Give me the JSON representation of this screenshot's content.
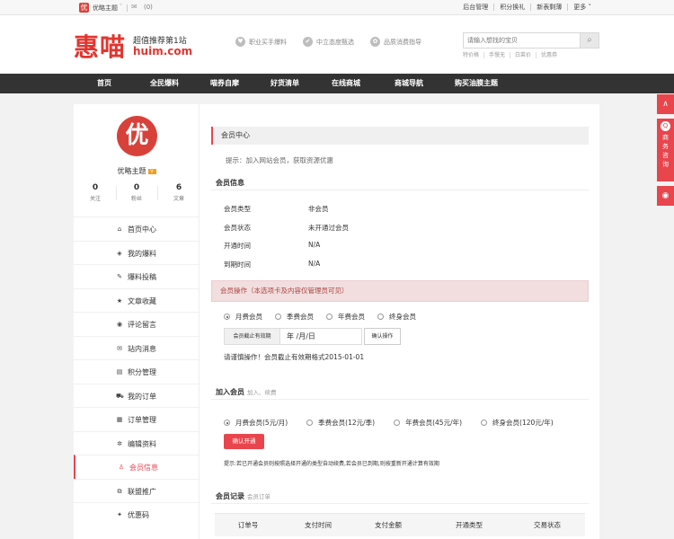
{
  "topbar": {
    "logo_glyph": "优",
    "site_name": "优略主题",
    "caret": "˅",
    "mail_icon": "✉",
    "mail_count": "(0)",
    "links": [
      "后台管理",
      "积分换礼",
      "新表剩薄",
      "更多 ˅"
    ]
  },
  "header": {
    "brand_cn": "惠喵",
    "tagline": "超值推荐第1站",
    "url": "huim.com",
    "features": [
      {
        "icon": "heart-icon",
        "glyph": "♥",
        "label": "职业买手爆料"
      },
      {
        "icon": "check-icon",
        "glyph": "✔",
        "label": "中立态度甄选"
      },
      {
        "icon": "thumb-icon",
        "glyph": "✿",
        "label": "品质消费指导"
      }
    ],
    "search_placeholder": "请输入想找的宝贝",
    "search_glyph": "⌕",
    "hotwords": [
      "特价格",
      "手慢无",
      "白菜价",
      "优惠券"
    ]
  },
  "nav": {
    "items": [
      "首页",
      "全民爆料",
      "喵券自摩",
      "好货清单",
      "在线商城",
      "商城导航",
      "购买油膜主题"
    ]
  },
  "float": {
    "top_glyph": "∧",
    "qq_glyph": "Q",
    "qq_label": [
      "商",
      "务",
      "咨",
      "询"
    ],
    "weibo_glyph": "◉"
  },
  "sidebar": {
    "avatar_glyph": "优",
    "username": "优略主题",
    "vip_badge": "V",
    "stats": [
      {
        "value": "0",
        "label": "关注"
      },
      {
        "value": "0",
        "label": "粉丝"
      },
      {
        "value": "6",
        "label": "文章"
      }
    ],
    "menu": [
      {
        "icon": "home-icon",
        "glyph": "⌂",
        "label": "首页中心",
        "active": false
      },
      {
        "icon": "tag-icon",
        "glyph": "◈",
        "label": "我的爆料",
        "active": false
      },
      {
        "icon": "edit-icon",
        "glyph": "✎",
        "label": "爆料投稿",
        "active": false
      },
      {
        "icon": "star-icon",
        "glyph": "★",
        "label": "文章收藏",
        "active": false
      },
      {
        "icon": "comment-icon",
        "glyph": "◉",
        "label": "评论留言",
        "active": false
      },
      {
        "icon": "envelope-icon",
        "glyph": "✉",
        "label": "站内消息",
        "active": false
      },
      {
        "icon": "card-icon",
        "glyph": "▤",
        "label": "积分管理",
        "active": false
      },
      {
        "icon": "cart-icon",
        "glyph": "⛟",
        "label": "我的订单",
        "active": false
      },
      {
        "icon": "list-icon",
        "glyph": "▦",
        "label": "订单管理",
        "active": false
      },
      {
        "icon": "gear-icon",
        "glyph": "✲",
        "label": "编辑资料",
        "active": false
      },
      {
        "icon": "user-icon",
        "glyph": "♙",
        "label": "会员信息",
        "active": true
      },
      {
        "icon": "share-icon",
        "glyph": "⧉",
        "label": "联盟推广",
        "active": false
      },
      {
        "icon": "ticket-icon",
        "glyph": "✦",
        "label": "优惠码",
        "active": false
      }
    ]
  },
  "content": {
    "page_title": "会员中心",
    "tip": "提示：加入网站会员，获取资源优惠",
    "info_section": "会员信息",
    "info_rows": [
      {
        "k": "会员类型",
        "v": "非会员"
      },
      {
        "k": "会员状态",
        "v": "未开通过会员"
      },
      {
        "k": "开通时间",
        "v": "N/A"
      },
      {
        "k": "到期时间",
        "v": "N/A"
      }
    ],
    "alert": "会员操作（本选项卡及内容仅管理员可见）",
    "op_options": [
      "月费会员",
      "季费会员",
      "年费会员",
      "终身会员"
    ],
    "date_label": "会员截止有效期",
    "date_value": "年 /月/日",
    "confirm_op": "确认操作",
    "op_note": "请谨慎操作！会员截止有效期格式2015-01-01",
    "join_section": "加入会员",
    "join_sub": "加入、续费",
    "join_options": [
      "月费会员(5元/月)",
      "季费会员(12元/季)",
      "年费会员(45元/年)",
      "终身会员(120元/年)"
    ],
    "confirm_open": "确认开通",
    "join_hint": "提示:若已开通会员则按照选择开通的类型自动续费,若会员已到期,则按重新开通计算有效期",
    "record_section": "会员记录",
    "record_sub": "会员订单",
    "table_headers": [
      "订单号",
      "支付时间",
      "支付金额",
      "开通类型",
      "交易状态"
    ]
  }
}
